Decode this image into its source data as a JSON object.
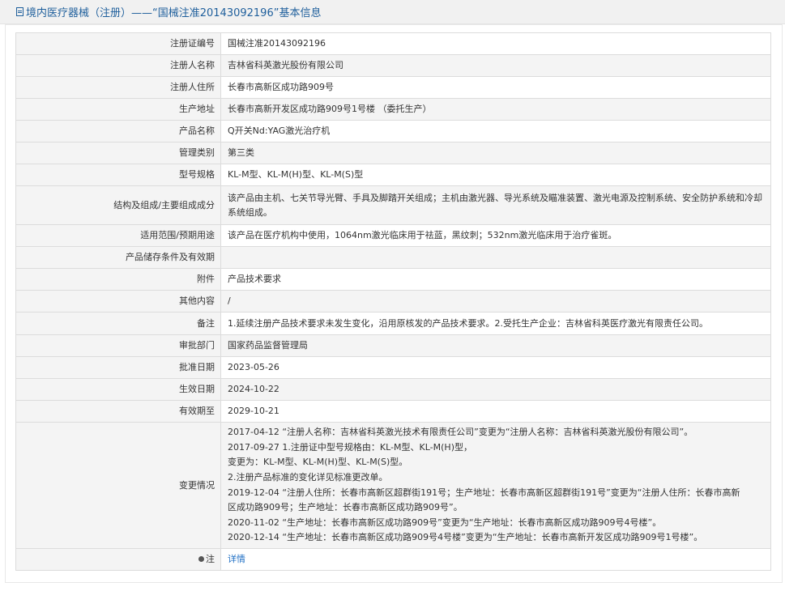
{
  "header": {
    "title": "境内医疗器械（注册）——“国械注准20143092196”基本信息"
  },
  "rows": [
    {
      "label": "注册证编号",
      "value": "国械注准20143092196"
    },
    {
      "label": "注册人名称",
      "value": "吉林省科英激光股份有限公司"
    },
    {
      "label": "注册人住所",
      "value": "长春市高新区成功路909号"
    },
    {
      "label": "生产地址",
      "value": "长春市高新开发区成功路909号1号楼 （委托生产）"
    },
    {
      "label": "产品名称",
      "value": "Q开关Nd:YAG激光治疗机"
    },
    {
      "label": "管理类别",
      "value": "第三类"
    },
    {
      "label": "型号规格",
      "value": "KL-M型、KL-M(H)型、KL-M(S)型"
    },
    {
      "label": "结构及组成/主要组成成分",
      "value": "该产品由主机、七关节导光臂、手具及脚踏开关组成；主机由激光器、导光系统及瞄准装置、激光电源及控制系统、安全防护系统和冷却系统组成。"
    },
    {
      "label": "适用范围/预期用途",
      "value": "该产品在医疗机构中使用，1064nm激光临床用于祛蓝，黑纹刺；532nm激光临床用于治疗雀斑。"
    },
    {
      "label": "产品储存条件及有效期",
      "value": ""
    },
    {
      "label": "附件",
      "value": "产品技术要求"
    },
    {
      "label": "其他内容",
      "value": "/"
    },
    {
      "label": "备注",
      "value": "1.延续注册产品技术要求未发生变化，沿用原核发的产品技术要求。2.受托生产企业：吉林省科英医疗激光有限责任公司。"
    },
    {
      "label": "审批部门",
      "value": "国家药品监督管理局"
    },
    {
      "label": "批准日期",
      "value": "2023-05-26"
    },
    {
      "label": "生效日期",
      "value": "2024-10-22"
    },
    {
      "label": "有效期至",
      "value": "2029-10-21"
    }
  ],
  "changes": {
    "label": "变更情况",
    "lines": [
      "2017-04-12 “注册人名称：吉林省科英激光技术有限责任公司”变更为“注册人名称：吉林省科英激光股份有限公司”。",
      "2017-09-27 1.注册证中型号规格由：KL-M型、KL-M(H)型，",
      "变更为：KL-M型、KL-M(H)型、KL-M(S)型。",
      "2.注册产品标准的变化详见标准更改单。",
      "2019-12-04 “注册人住所：长春市高新区超群街191号；生产地址：长春市高新区超群街191号”变更为“注册人住所：长春市高新",
      "区成功路909号；生产地址：长春市高新区成功路909号”。",
      "2020-11-02 “生产地址：长春市高新区成功路909号”变更为“生产地址：长春市高新区成功路909号4号楼”。",
      "2020-12-14 “生产地址：长春市高新区成功路909号4号楼”变更为“生产地址：长春市高新开发区成功路909号1号楼”。"
    ]
  },
  "note": {
    "label": "注",
    "link_text": "详情"
  }
}
